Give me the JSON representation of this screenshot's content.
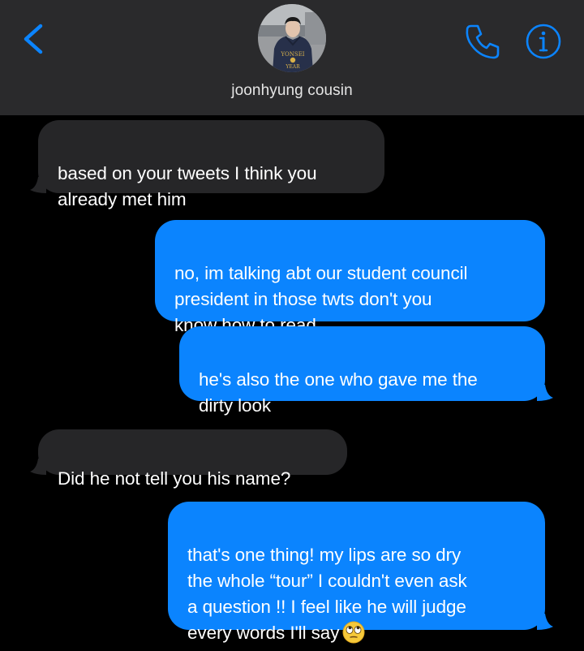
{
  "header": {
    "contact_name": "joonhyung cousin",
    "avatar_alt": "contact photo",
    "avatar_hoodie_text_1": "YONSEI",
    "avatar_hoodie_text_2": "YEAR"
  },
  "colors": {
    "header_bg": "#2a2a2c",
    "accent_blue": "#0b84fe",
    "received_bubble": "#262628",
    "sent_bubble": "#0b84fe",
    "background": "#000000"
  },
  "icons": {
    "back": "chevron-left-icon",
    "call": "phone-icon",
    "info": "info-icon",
    "emoji": "face-with-rolling-eyes"
  },
  "messages": [
    {
      "direction": "received",
      "text": "based on your tweets I think you\nalready met him"
    },
    {
      "direction": "sent",
      "text": "no, im talking abt our student council\npresident in those twts don't you\nknow how to read"
    },
    {
      "direction": "sent",
      "text": "he's also the one who gave me the\ndirty look"
    },
    {
      "direction": "received",
      "text": "Did he not tell you his name?"
    },
    {
      "direction": "sent",
      "text": "that's one thing! my lips are so dry\nthe whole “tour” I couldn't even ask\na question !! I feel like he will judge\nevery words I'll say",
      "emoji": "🙄"
    }
  ]
}
